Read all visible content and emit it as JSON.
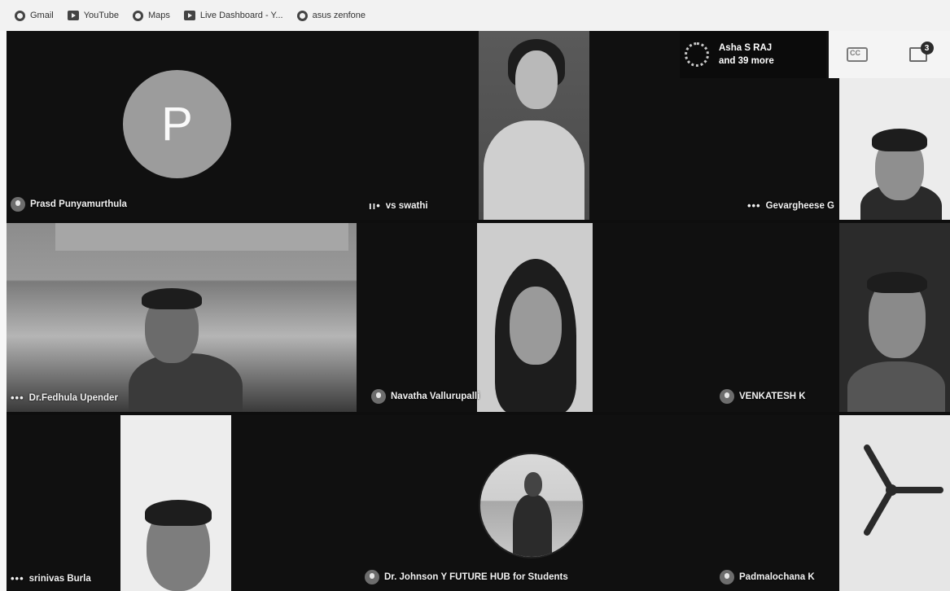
{
  "bookmarks": [
    {
      "label": "Gmail",
      "icon": "globe-icon"
    },
    {
      "label": "YouTube",
      "icon": "youtube-icon"
    },
    {
      "label": "Maps",
      "icon": "globe-icon"
    },
    {
      "label": "Live Dashboard - Y...",
      "icon": "youtube-icon"
    },
    {
      "label": "asus zenfone",
      "icon": "globe-icon"
    }
  ],
  "meeting": {
    "participants_summary": {
      "line1": "Asha S RAJ",
      "line2": "and 39 more"
    },
    "chat_badge": "3",
    "tiles": [
      {
        "name": "Prasd Punyamurthula",
        "avatar_letter": "P"
      },
      {
        "name": "vs swathi"
      },
      {
        "name": "Gevargheese G"
      },
      {
        "name": "Dr.Fedhula Upender"
      },
      {
        "name": "Navatha Vallurupalli"
      },
      {
        "name": "VENKATESH K"
      },
      {
        "name": "srinivas Burla"
      },
      {
        "name": "Dr. Johnson Y FUTURE HUB for Students"
      },
      {
        "name": "Padmalochana K"
      }
    ]
  }
}
